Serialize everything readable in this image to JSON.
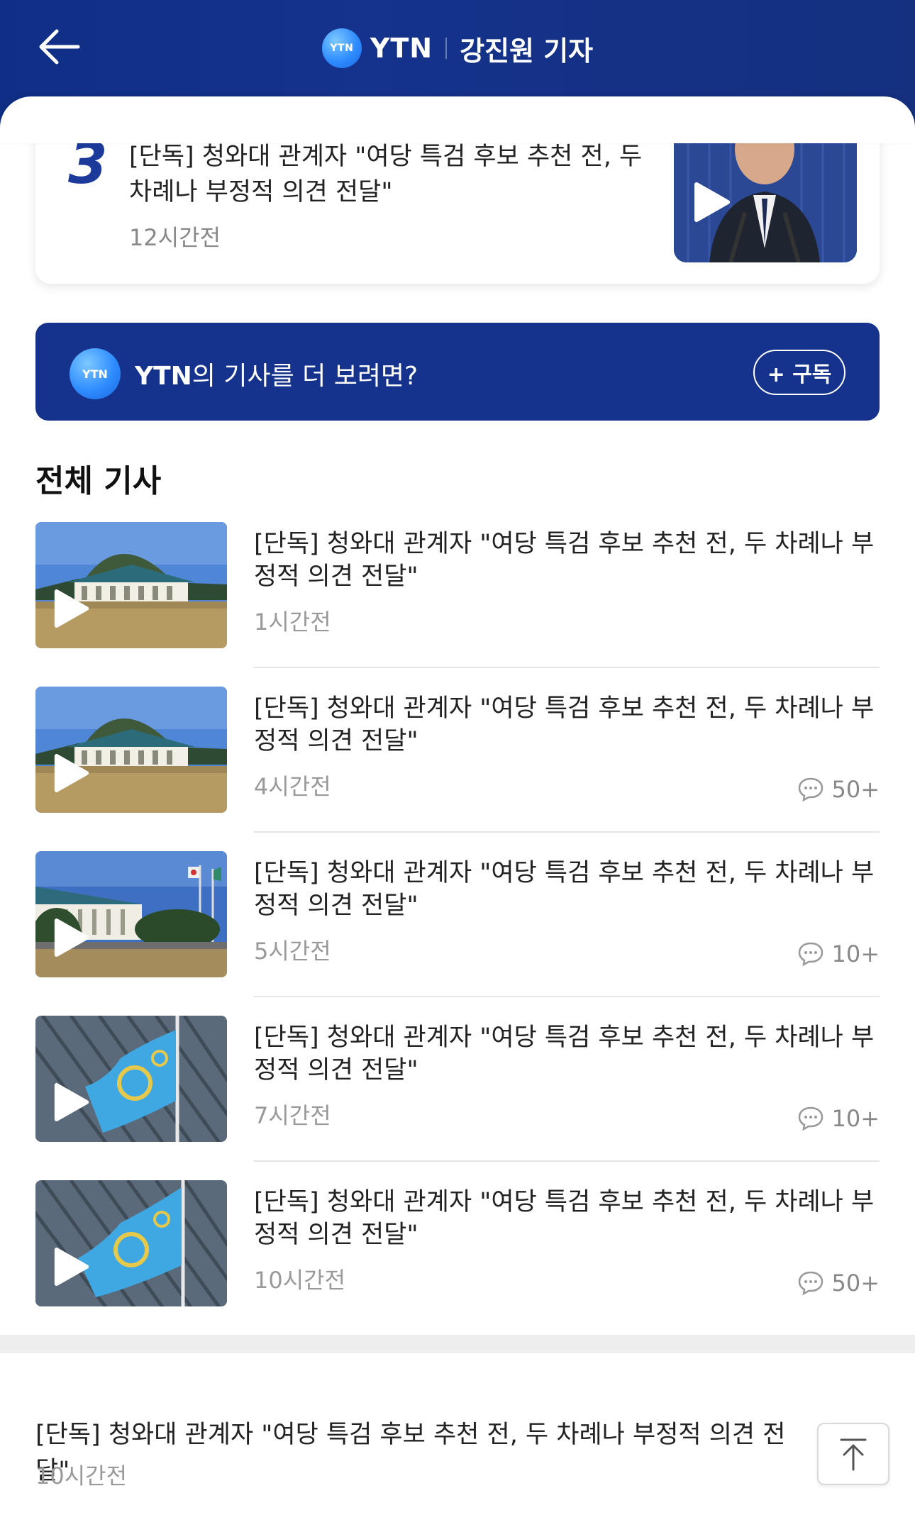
{
  "header": {
    "logo_text": "YTN",
    "brand": "YTN",
    "reporter": "강진원 기자"
  },
  "ranked": {
    "rank": "3",
    "title": "[단독] 청와대 관계자 \"여당 특검 후보 추천 전, 두 차례나 부정적 의견 전달\"",
    "time": "12시간전"
  },
  "subscribe": {
    "logo_text": "YTN",
    "brand": "YTN",
    "text": "의 기사를 더 보려면?",
    "button": "+ 구독"
  },
  "section_title": "전체 기사",
  "articles": [
    {
      "title": "[단독] 청와대 관계자 \"여당 특검 후보 추천 전, 두 차례나 부정적 의견 전달\"",
      "time": "1시간전",
      "comments": ""
    },
    {
      "title": "[단독] 청와대 관계자 \"여당 특검 후보 추천 전, 두 차례나 부정적 의견 전달\"",
      "time": "4시간전",
      "comments": "50+"
    },
    {
      "title": "[단독] 청와대 관계자 \"여당 특검 후보 추천 전, 두 차례나 부정적 의견 전달\"",
      "time": "5시간전",
      "comments": "10+"
    },
    {
      "title": "[단독] 청와대 관계자 \"여당 특검 후보 추천 전, 두 차례나 부정적 의견 전달\"",
      "time": "7시간전",
      "comments": "10+"
    },
    {
      "title": "[단독] 청와대 관계자 \"여당 특검 후보 추천 전, 두 차례나 부정적 의견 전달\"",
      "time": "10시간전",
      "comments": "50+"
    }
  ],
  "bottom_article": {
    "title": "[단독] 청와대 관계자 \"여당 특검 후보 추천 전, 두 차례나 부정적 의견 전달\"",
    "time": "10시간전"
  },
  "icons": {
    "back": "back-arrow-icon",
    "play": "play-icon",
    "comment": "comment-bubble-icon",
    "scroll_top": "scroll-to-top-icon"
  },
  "colors": {
    "header_bg": "#15328c",
    "accent": "#1c3a9a",
    "logo": "#2f8dff"
  }
}
